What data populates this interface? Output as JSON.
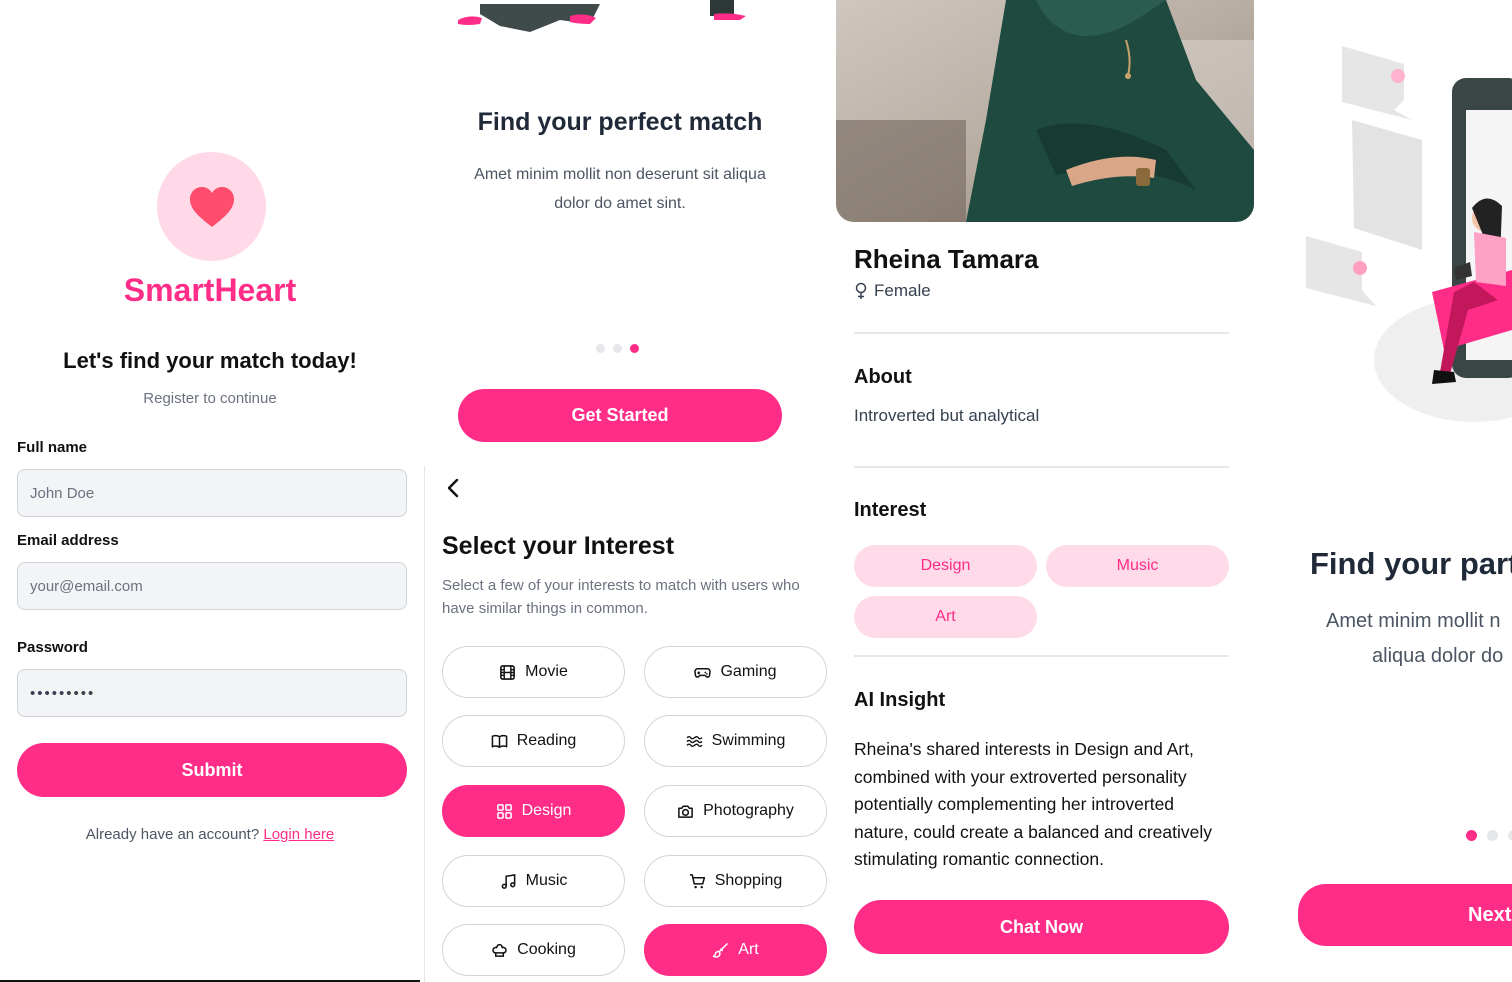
{
  "colors": {
    "accent": "#ff2d87",
    "accent_light": "#ffdbea",
    "text": "#111827",
    "muted": "#6b7280"
  },
  "register": {
    "brand": "SmartHeart",
    "title": "Let's find your match today!",
    "subtitle": "Register to continue",
    "fields": [
      {
        "label": "Full name",
        "placeholder": "John Doe"
      },
      {
        "label": "Email address",
        "placeholder": "your@email.com"
      },
      {
        "label": "Password",
        "value": "•••••••••"
      }
    ],
    "submit": "Submit",
    "login_prompt": "Already have an account?",
    "login_link": "Login here"
  },
  "onboarding": {
    "title": "Find your perfect match",
    "description": "Amet minim mollit non deserunt sit aliqua dolor do amet sint.",
    "button": "Get Started"
  },
  "interests": {
    "back_icon": "chevron-left-icon",
    "title": "Select your Interest",
    "subtitle": "Select a few of your interests to match with users who have similar things in common.",
    "options": [
      {
        "label": "Movie",
        "icon": "film-icon",
        "selected": false
      },
      {
        "label": "Gaming",
        "icon": "gamepad-icon",
        "selected": false
      },
      {
        "label": "Reading",
        "icon": "book-icon",
        "selected": false
      },
      {
        "label": "Swimming",
        "icon": "waves-icon",
        "selected": false
      },
      {
        "label": "Design",
        "icon": "grid-icon",
        "selected": true
      },
      {
        "label": "Photography",
        "icon": "camera-icon",
        "selected": false
      },
      {
        "label": "Music",
        "icon": "music-icon",
        "selected": false
      },
      {
        "label": "Shopping",
        "icon": "cart-icon",
        "selected": false
      },
      {
        "label": "Cooking",
        "icon": "chef-hat-icon",
        "selected": false
      },
      {
        "label": "Art",
        "icon": "brush-icon",
        "selected": true
      }
    ]
  },
  "profile": {
    "name": "Rheina Tamara",
    "gender": "Female",
    "about_heading": "About",
    "about": "Introverted but analytical",
    "interest_heading": "Interest",
    "interests": [
      "Design",
      "Music",
      "Art"
    ],
    "insight_heading": "AI Insight",
    "insight": "Rheina's shared interests in Design and Art, combined with your extroverted personality potentially complementing her introverted nature, could create a balanced and creatively stimulating romantic connection.",
    "chat_button": "Chat Now"
  },
  "onboarding2": {
    "title": "Find your part",
    "desc_line1": "Amet minim mollit n",
    "desc_line2": "aliqua dolor do",
    "button": "Next"
  }
}
